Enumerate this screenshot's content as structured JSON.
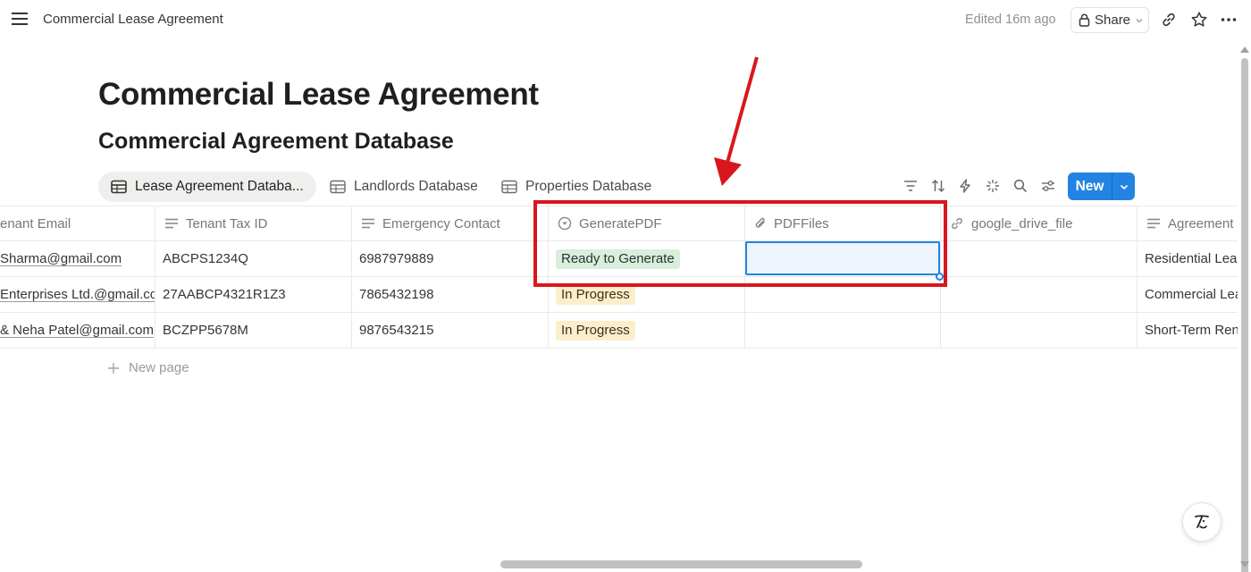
{
  "topbar": {
    "breadcrumb": "Commercial Lease Agreement",
    "edited": "Edited 16m ago",
    "share_label": "Share"
  },
  "page": {
    "title": "Commercial Lease Agreement",
    "database_title": "Commercial Agreement Database"
  },
  "views": [
    {
      "label": "Lease Agreement Databa...",
      "active": true
    },
    {
      "label": "Landlords Database",
      "active": false
    },
    {
      "label": "Properties Database",
      "active": false
    }
  ],
  "toolbar": {
    "new_label": "New"
  },
  "table": {
    "columns": [
      {
        "label": "enant Email",
        "icon": "lines-icon"
      },
      {
        "label": "Tenant Tax ID",
        "icon": "lines-icon"
      },
      {
        "label": "Emergency Contact",
        "icon": "lines-icon"
      },
      {
        "label": "GeneratePDF",
        "icon": "status-icon"
      },
      {
        "label": "PDFFiles",
        "icon": "paperclip-icon"
      },
      {
        "label": "google_drive_file",
        "icon": "link-icon"
      },
      {
        "label": "Agreement",
        "icon": "lines-icon"
      }
    ],
    "rows": [
      {
        "email": " Sharma@gmail.com",
        "tax_id": "ABCPS1234Q",
        "contact": "6987979889",
        "status": "Ready to Generate",
        "status_color": "green",
        "pdf": "",
        "drive": "",
        "agreement": "Residential Lease"
      },
      {
        "email": "Enterprises Ltd.@gmail.com",
        "tax_id": "27AABCP4321R1Z3",
        "contact": "7865432198",
        "status": "In Progress",
        "status_color": "yellow",
        "pdf": "",
        "drive": "",
        "agreement": "Commercial Lease"
      },
      {
        "email": "& Neha Patel@gmail.com",
        "tax_id": "BCZPP5678M",
        "contact": "9876543215",
        "status": "In Progress",
        "status_color": "yellow",
        "pdf": "",
        "drive": "",
        "agreement": "Short-Term Rental"
      }
    ],
    "new_page_label": "New page"
  },
  "colors": {
    "accent": "#2383e2",
    "annotation": "#d9161c",
    "tag_green": "#dbeddb",
    "tag_yellow": "#fbeecb"
  }
}
